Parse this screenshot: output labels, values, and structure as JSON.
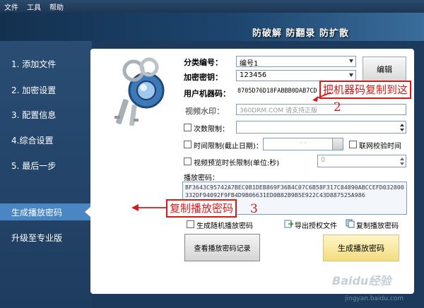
{
  "menu": [
    "文件",
    "工具",
    "帮助"
  ],
  "slogan": "防破解 防翻录 防扩散",
  "sidebar": {
    "items": [
      "1. 添加文件",
      "2. 加密设置",
      "3. 配置信息",
      "4.综合设置",
      "5. 最后一步"
    ],
    "actions": [
      "生成播放密码",
      "升级至专业版"
    ]
  },
  "form": {
    "category_label": "分类编号：",
    "category_value": "编号1",
    "key_label": "加密密钥：",
    "key_value": "123456",
    "edit_button": "编辑",
    "machine_code_label": "用户机器码：",
    "machine_code_value": "8705D76D18FABBB0DAB7CD",
    "watermark_label": "视频水印：",
    "watermark_placeholder": "360DRM.COM 请支持正版",
    "count_limit_label": "次数限制：",
    "time_limit_label": "时间限制(截止日期)：",
    "time_limit_value": "-   -",
    "online_check_label": "联网校验时间",
    "preview_limit_label": "视频预览时长限制(单位:秒)",
    "preview_value": "0",
    "play_password_label": "播放密码：",
    "play_password_value": "BF3643C95742A7BEC0B1DEB869F36B4C07C6B58F317C84890ABCCEFD032800332DF94092F9FB4D9B06631ED0B82B9B5E922C43D887525A986",
    "random_password_label": "生成随机播放密码",
    "export_license_label": "导出授权文件",
    "copy_password_label": "复制播放密码",
    "view_records_button": "查看播放密码记录",
    "generate_button": "生成播放密码"
  },
  "annotations": {
    "note1": "把机器码复制到这",
    "num1": "2",
    "note2": "复制播放密码",
    "num2": "3"
  },
  "watermark": {
    "logo": "Baidu经验",
    "url": "jingyan.baidu.com"
  },
  "colors": {
    "sidebar_active": "#4a86c4",
    "annotation_red": "#d21b1b",
    "generate_button": "#f3dc80"
  }
}
